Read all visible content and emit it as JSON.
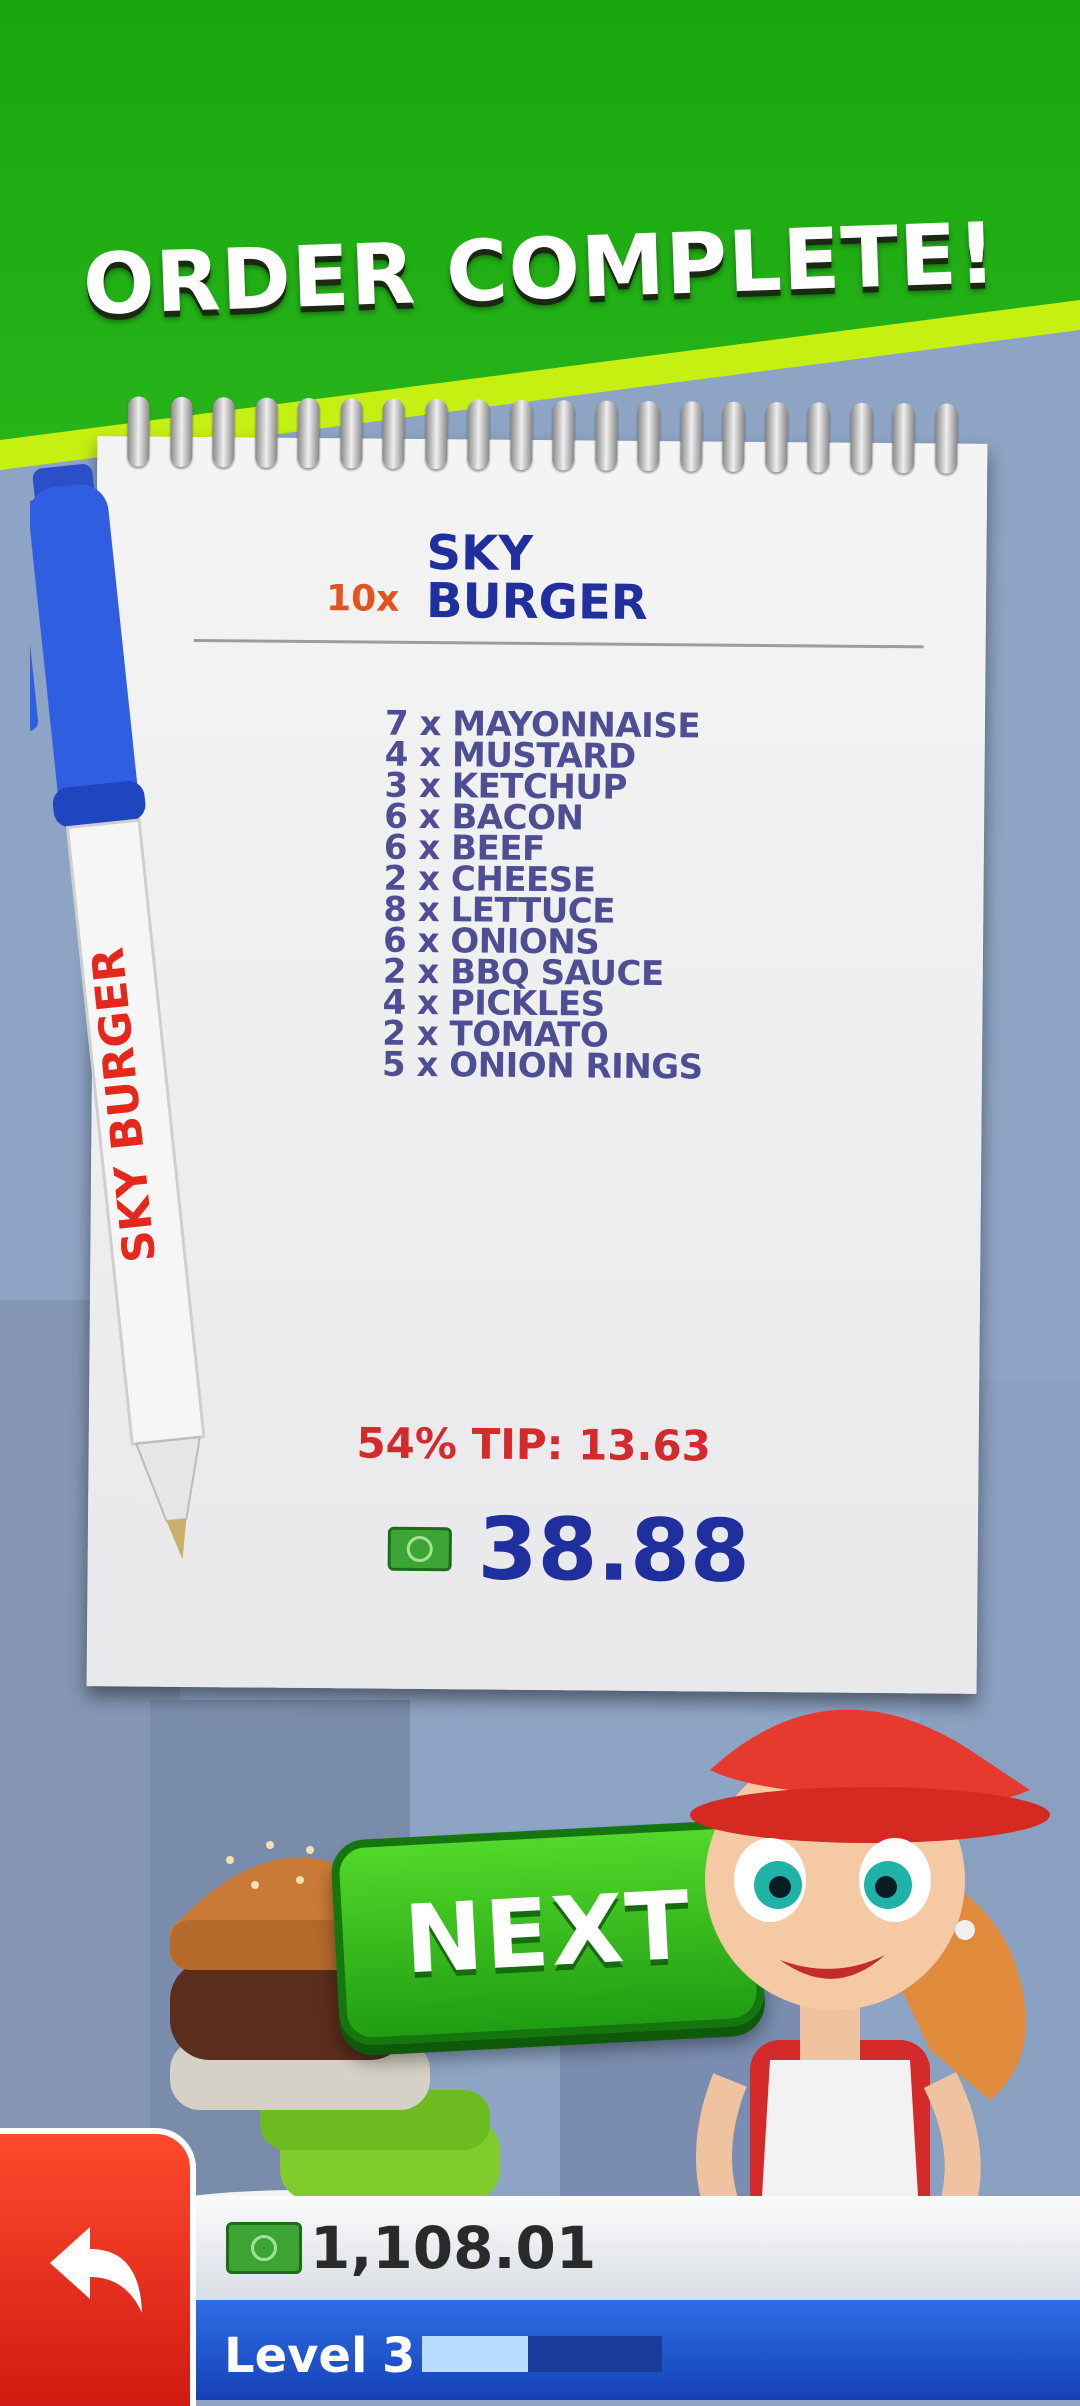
{
  "header": {
    "title": "ORDER COMPLETE!"
  },
  "order": {
    "quantity": "10x",
    "burger_name": [
      "SKY",
      "BURGER"
    ],
    "items": [
      "7 x MAYONNAISE",
      "4 x MUSTARD",
      "3 x KETCHUP",
      "6 x BACON",
      "6 x BEEF",
      "2 x CHEESE",
      "8 x LETTUCE",
      "6 x ONIONS",
      "2 x BBQ SAUCE",
      "4 x PICKLES",
      "2 x TOMATO",
      "5 x ONION RINGS"
    ],
    "tip": "54% TIP: 13.63",
    "total": "38.88"
  },
  "pen": {
    "brand_text": "SKY BURGER"
  },
  "buttons": {
    "next_label": "NEXT"
  },
  "footer": {
    "balance": "1,108.01",
    "level_label": "Level",
    "level_number": "3",
    "level_progress": 0.44
  },
  "colors": {
    "header_green": "#1faa12",
    "accent_yellow": "#c6f012",
    "ink_blue": "#1f2f9e",
    "tip_red": "#d32a2c",
    "back_red": "#e52a1a"
  },
  "icons": {
    "money": "money-bill-icon",
    "back": "back-arrow-icon"
  }
}
